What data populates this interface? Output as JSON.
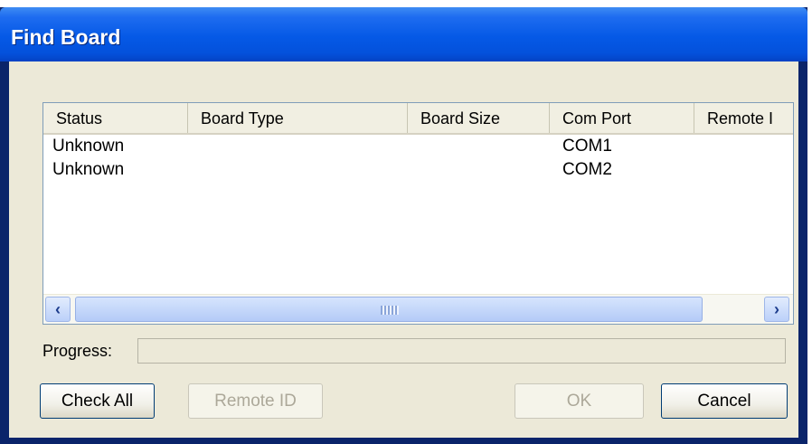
{
  "window": {
    "title": "Find Board"
  },
  "list": {
    "columns": [
      "Status",
      "Board Type",
      "Board Size",
      "Com Port",
      "Remote I"
    ],
    "rows": [
      {
        "status": "Unknown",
        "board_type": "",
        "board_size": "",
        "com_port": "COM1",
        "remote_id": ""
      },
      {
        "status": "Unknown",
        "board_type": "",
        "board_size": "",
        "com_port": "COM2",
        "remote_id": ""
      }
    ]
  },
  "scrollbar": {
    "left_arrow": "‹",
    "right_arrow": "›",
    "left_icon": "chevron-left-icon",
    "right_icon": "chevron-right-icon"
  },
  "progress": {
    "label": "Progress:",
    "value": 0
  },
  "buttons": {
    "check_all": "Check All",
    "remote_id": "Remote ID",
    "ok": "OK",
    "cancel": "Cancel"
  },
  "colors": {
    "title_bar": "#0559e6",
    "dialog_bg": "#ece9d8",
    "button_border": "#003c74",
    "disabled_text": "#aca899"
  }
}
